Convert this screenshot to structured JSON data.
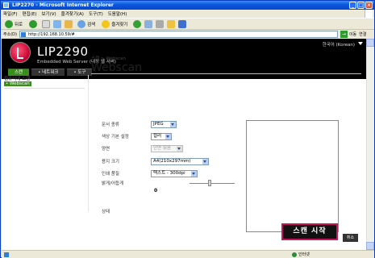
{
  "window": {
    "title": "LIP2270 - Microsoft Internet Explorer"
  },
  "menu": [
    "파일(F)",
    "편집(E)",
    "보기(V)",
    "즐겨찾기(A)",
    "도구(T)",
    "도움말(H)"
  ],
  "toolbar": {
    "back_label": "뒤로",
    "search_label": "검색",
    "favorites_label": "즐겨찾기"
  },
  "address": {
    "label": "주소(D)",
    "url": "http://192.168.10.59/#",
    "go_label": "이동",
    "links_label": "연결"
  },
  "header": {
    "product": "LIP2290",
    "subtitle": "Embedded Web Server (내장 웹 서버)",
    "language": "한국어 (Korean)",
    "tabs": [
      "스캔",
      "• 네트워크",
      "• 도구"
    ]
  },
  "breadcrumb": "스캔 > Webscan",
  "page_title": "Webscan",
  "sidebar": {
    "title": "컴퓨터에 스캔",
    "item": "• Webscan"
  },
  "form": {
    "doc_type": {
      "label": "문서 종류",
      "value": "JPEG"
    },
    "color": {
      "label": "색상 기본 설정",
      "value": "컬러"
    },
    "duplex": {
      "label": "양면",
      "value": "단면 읽음"
    },
    "paper": {
      "label": "용지 크기",
      "value": "A4(210x297mm)"
    },
    "quality": {
      "label": "인쇄 품질",
      "value": "텍스트 - 300dpi"
    },
    "contrast": {
      "label": "밝게/어둡게",
      "value": "0"
    },
    "status": {
      "label": "상태"
    }
  },
  "buttons": {
    "scan": "스캔 시작",
    "cancel": "취소"
  },
  "statusbar": {
    "zone": "인터넷"
  }
}
